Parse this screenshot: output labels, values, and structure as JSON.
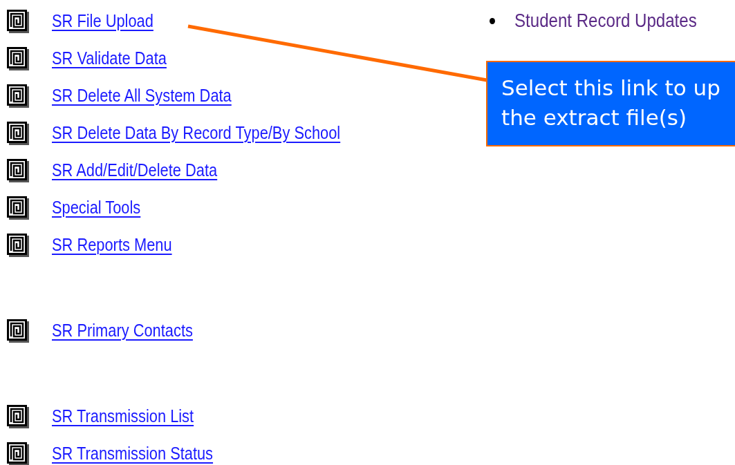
{
  "menu_groups": [
    {
      "links": [
        {
          "label": "SR File Upload"
        },
        {
          "label": "SR Validate Data"
        },
        {
          "label": "SR Delete All System Data"
        },
        {
          "label": "SR Delete Data By Record Type/By School"
        },
        {
          "label": "SR Add/Edit/Delete Data"
        },
        {
          "label": "Special Tools"
        },
        {
          "label": "SR Reports Menu"
        }
      ]
    },
    {
      "links": [
        {
          "label": "SR Primary Contacts"
        }
      ]
    },
    {
      "links": [
        {
          "label": "SR Transmission List"
        },
        {
          "label": "SR Transmission Status"
        }
      ]
    }
  ],
  "side_list": [
    {
      "label": "Student Record Updates"
    }
  ],
  "callout": {
    "lines": [
      "Select this link to up",
      "the extract file(s)"
    ]
  }
}
